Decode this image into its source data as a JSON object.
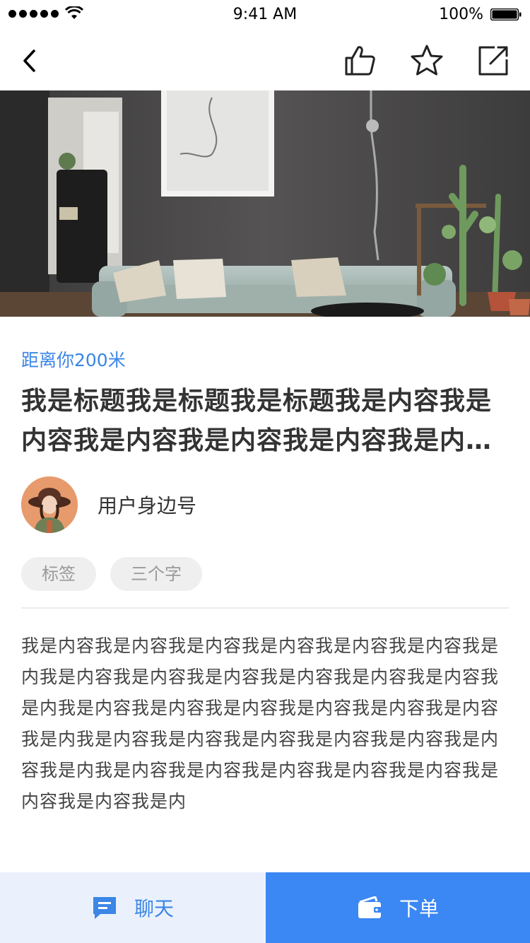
{
  "status_bar": {
    "time": "9:41 AM",
    "battery": "100%",
    "signal_icon": "signal-dots-icon",
    "wifi_icon": "wifi-icon",
    "battery_icon": "battery-icon"
  },
  "nav": {
    "back_icon": "chevron-left-icon",
    "like_icon": "thumbs-up-icon",
    "favorite_icon": "star-icon",
    "share_icon": "share-external-icon"
  },
  "hero_image": "living-room-photo",
  "content": {
    "distance": "距离你200米",
    "title": "我是标题我是标题我是标题我是内容我是内容我是内容我是内容我是内容我是内容我是内容",
    "author_name": "用户身边号",
    "tags": [
      "标签",
      "三个字"
    ],
    "body": "我是内容我是内容我是内容我是内容我是内容我是内容我是内我是内容我是内容我是内容我是内容我是内容我是内容我是内我是内容我是内容我是内容我是内容我是内容我是内容我是内我是内容我是内容我是内容我是内容我是内容我是内容我是内我是内容我是内容我是内容我是内容我是内容我是内容我是内容我是内"
  },
  "bottom_bar": {
    "chat_label": "聊天",
    "order_label": "下单",
    "chat_icon": "chat-bubble-icon",
    "order_icon": "wallet-icon"
  },
  "colors": {
    "accent": "#3b86e6",
    "primary_button": "#3b87f3",
    "secondary_button_bg": "#eaf1fc",
    "tag_bg": "#efefef"
  }
}
